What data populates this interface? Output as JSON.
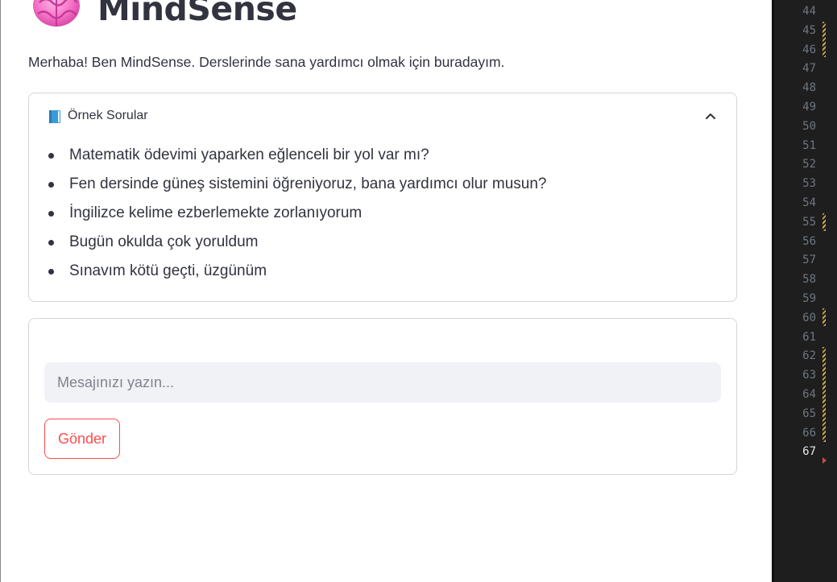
{
  "app": {
    "title": "MindSense",
    "title_icon": "brain-icon",
    "intro": "Merhaba! Ben MindSense. Derslerinde sana yardımcı olmak için buradayım."
  },
  "expander": {
    "icon": "book-icon",
    "title": "Örnek Sorular",
    "expanded": true,
    "toggle_icon": "chevron-up-icon",
    "questions": [
      "Matematik ödevimi yaparken eğlenceli bir yol var mı?",
      "Fen dersinde güneş sistemini öğreniyoruz, bana yardımcı olur musun?",
      "İngilizce kelime ezberlemekte zorlanıyorum",
      "Bugün okulda çok yoruldum",
      "Sınavım kötü geçti, üzgünüm"
    ]
  },
  "form": {
    "input_value": "",
    "input_placeholder": "Mesajınızı yazın...",
    "send_label": "Gönder"
  },
  "editor": {
    "line_numbers": [
      "44",
      "45",
      "46",
      "47",
      "48",
      "49",
      "50",
      "51",
      "52",
      "53",
      "54",
      "55",
      "56",
      "57",
      "58",
      "59",
      "60",
      "61",
      "62",
      "63",
      "64",
      "65",
      "66",
      "67"
    ],
    "current_line": "67"
  },
  "colors": {
    "text": "#31333f",
    "accent": "#ff4b4b",
    "border": "#d6d6d9",
    "input_bg": "#f0f2f6",
    "editor_bg": "#1e1e1e",
    "line_number": "#6e7681",
    "diff_marker": "#c9a64a"
  }
}
